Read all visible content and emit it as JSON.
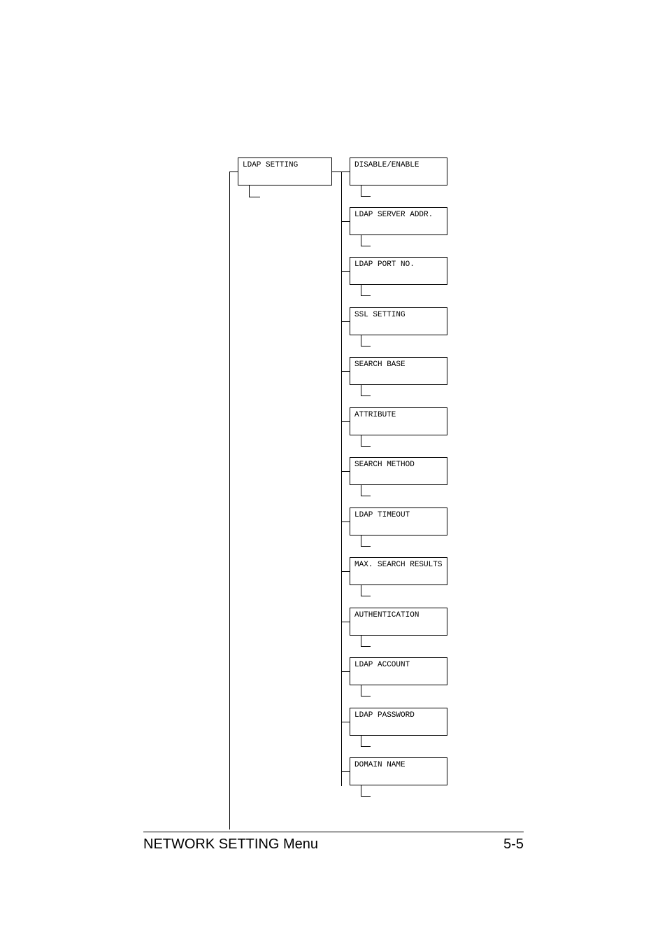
{
  "diagram": {
    "root": "LDAP SETTING",
    "children": [
      "DISABLE/ENABLE",
      "LDAP SERVER ADDR.",
      "LDAP PORT NO.",
      "SSL SETTING",
      "SEARCH BASE",
      "ATTRIBUTE",
      "SEARCH METHOD",
      "LDAP TIMEOUT",
      "MAX. SEARCH RESULTS",
      "AUTHENTICATION",
      "LDAP ACCOUNT",
      "LDAP PASSWORD",
      "DOMAIN NAME"
    ]
  },
  "footer": {
    "title": "NETWORK SETTING Menu",
    "page": "5-5"
  }
}
